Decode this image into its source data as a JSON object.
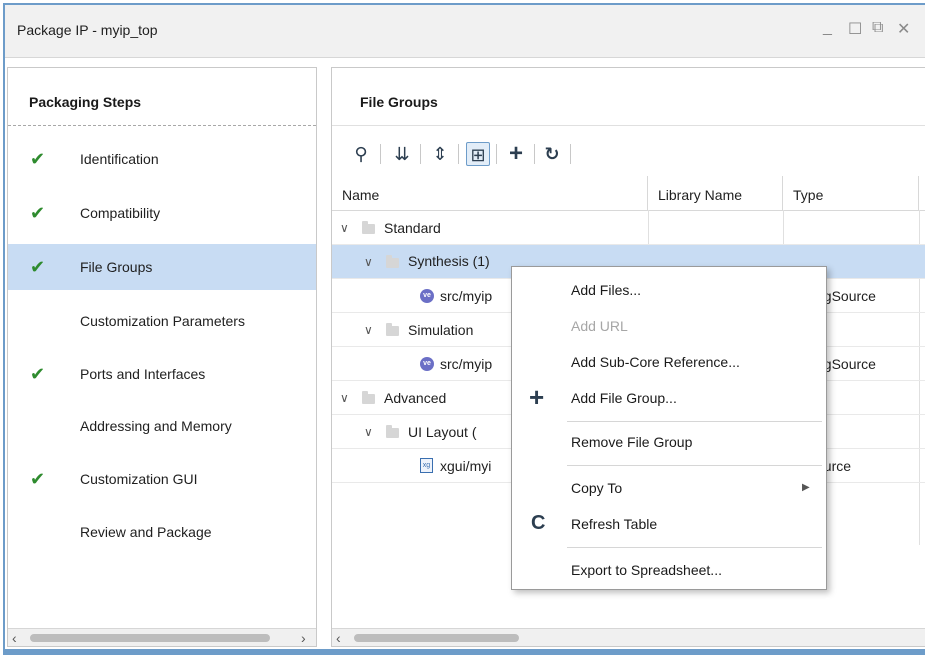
{
  "window": {
    "title": "Package IP - myip_top",
    "controls": {
      "minimize": "_",
      "maximize": "☐",
      "restore": "⧉",
      "close": "✕"
    }
  },
  "left_panel": {
    "title": "Packaging Steps",
    "steps": [
      {
        "label": "Identification",
        "checked": true,
        "selected": false
      },
      {
        "label": "Compatibility",
        "checked": true,
        "selected": false
      },
      {
        "label": "File Groups",
        "checked": true,
        "selected": true
      },
      {
        "label": "Customization Parameters",
        "checked": false,
        "selected": false
      },
      {
        "label": "Ports and Interfaces",
        "checked": true,
        "selected": false
      },
      {
        "label": "Addressing and Memory",
        "checked": false,
        "selected": false
      },
      {
        "label": "Customization GUI",
        "checked": true,
        "selected": false
      },
      {
        "label": "Review and Package",
        "checked": false,
        "selected": false
      }
    ],
    "check_glyph": "✔"
  },
  "right_panel": {
    "title": "File Groups",
    "toolbar": {
      "search": "⚲",
      "collapse_all": "⇊",
      "expand_all": "⇕",
      "hierarchy": "⊞",
      "add": "+",
      "refresh": "↻"
    },
    "columns": [
      "Name",
      "Library Name",
      "Type"
    ],
    "rows": [
      {
        "name": "Standard",
        "type": ""
      },
      {
        "name": "Synthesis (1)",
        "type": ""
      },
      {
        "name": "src/myip",
        "type": "ogSource"
      },
      {
        "name": "Simulation",
        "type": ""
      },
      {
        "name": "src/myip",
        "type": "ogSource"
      },
      {
        "name": "Advanced",
        "type": ""
      },
      {
        "name": "UI Layout (",
        "type": ""
      },
      {
        "name": "xgui/myi",
        "type": "ource"
      }
    ],
    "arrow_expanded": "∨",
    "file_badge_ve": "ve",
    "file_badge_xg": "xg"
  },
  "context_menu": {
    "items": [
      {
        "label": "Add Files...",
        "disabled": false
      },
      {
        "label": "Add URL",
        "disabled": true
      },
      {
        "label": "Add Sub-Core Reference...",
        "disabled": false
      },
      {
        "label": "Add File Group...",
        "disabled": false,
        "icon": "+"
      },
      {
        "label": "Remove File Group",
        "disabled": false
      },
      {
        "label": "Copy To",
        "disabled": false,
        "submenu": "▶"
      },
      {
        "label": "Refresh Table",
        "disabled": false,
        "icon": "C"
      },
      {
        "label": "Export to Spreadsheet...",
        "disabled": false
      }
    ]
  },
  "scroll": {
    "left": "‹",
    "right": "›"
  },
  "colors": {
    "accent": "#6d9cc9",
    "selection": "#c8dcf3",
    "check": "#2e8b2e"
  }
}
